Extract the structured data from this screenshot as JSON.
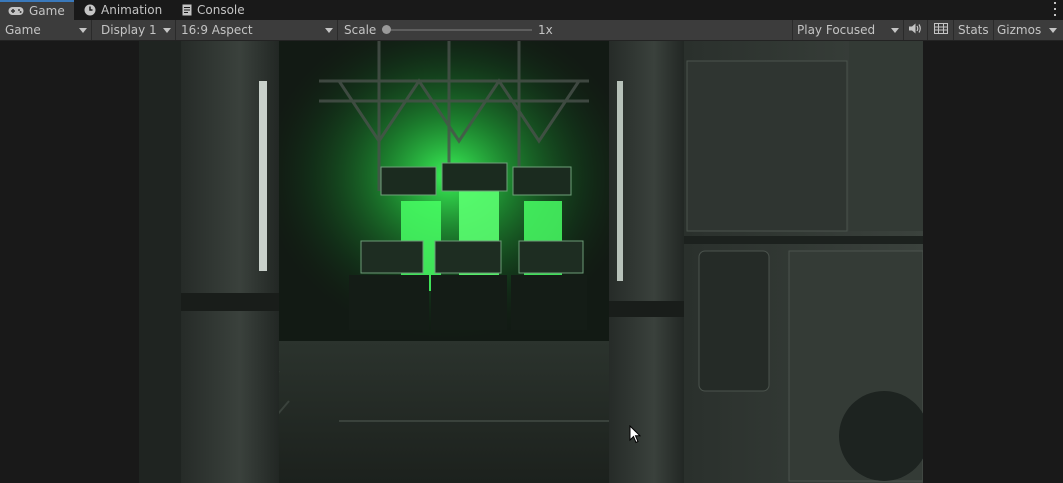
{
  "window": {
    "tabs": [
      {
        "label": "Game",
        "icon": "gamepad-icon",
        "active": true
      },
      {
        "label": "Animation",
        "icon": "clock-icon",
        "active": false
      },
      {
        "label": "Console",
        "icon": "console-icon",
        "active": false
      }
    ]
  },
  "toolbar": {
    "view_mode": "Game",
    "display": "Display 1",
    "aspect": "16:9 Aspect",
    "scale_label": "Scale",
    "scale_value": "1x",
    "scale_level": 0,
    "play_mode": "Play Focused",
    "stats_label": "Stats",
    "gizmos_label": "Gizmos",
    "icons": [
      "speaker-icon",
      "grid-icon"
    ]
  },
  "colors": {
    "tab_accent": "#3a79bb",
    "toolbar_bg": "#3c3c3c",
    "panel_bg": "#191919",
    "scene_green": "#3cff5a"
  }
}
